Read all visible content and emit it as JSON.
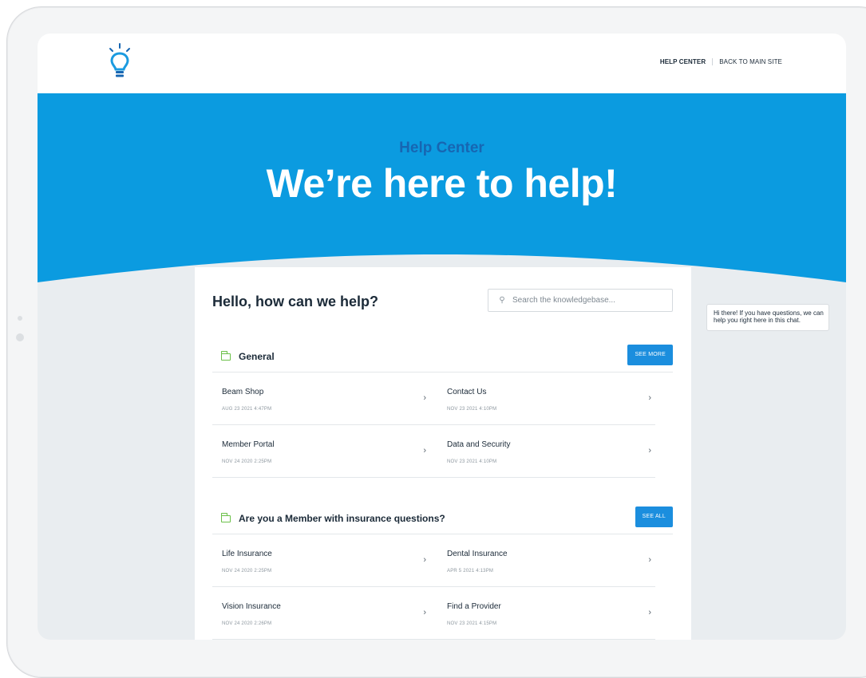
{
  "nav": {
    "help_center": "HELP CENTER",
    "back_to_main": "BACK TO MAIN SITE"
  },
  "hero": {
    "kicker": "Help Center",
    "title": "We’re here to help!"
  },
  "main": {
    "title": "Hello, how can we help?",
    "search_placeholder": "Search the knowledgebase...",
    "sections": [
      {
        "title": "General",
        "button": "SEE MORE",
        "items": [
          {
            "title": "Beam Shop",
            "date": "AUG 23 2021 4:47PM"
          },
          {
            "title": "Contact Us",
            "date": "NOV 23 2021 4:10PM"
          },
          {
            "title": "Member Portal",
            "date": "NOV 24 2020 2:25PM"
          },
          {
            "title": "Data and Security",
            "date": "NOV 23 2021 4:10PM"
          }
        ]
      },
      {
        "title": "Are you a Member with insurance questions?",
        "button": "SEE ALL",
        "items": [
          {
            "title": "Life Insurance",
            "date": "NOV 24 2020 2:25PM"
          },
          {
            "title": "Dental Insurance",
            "date": "APR 5 2021 4:13PM"
          },
          {
            "title": "Vision Insurance",
            "date": "NOV 24 2020 2:26PM"
          },
          {
            "title": "Find a Provider",
            "date": "NOV 23 2021 4:15PM"
          }
        ]
      }
    ]
  },
  "chat": {
    "message": "Hi there! If you have questions, we can help you right here in this chat."
  },
  "colors": {
    "hero_blue": "#0b9be0",
    "kicker_blue": "#1766b2",
    "button_blue": "#1b8ede",
    "folder_green": "#6cc04a"
  },
  "icons": {
    "logo": "lightbulb-icon",
    "search": "search-icon",
    "folder": "folder-icon",
    "chevron": "chevron-right-icon"
  }
}
